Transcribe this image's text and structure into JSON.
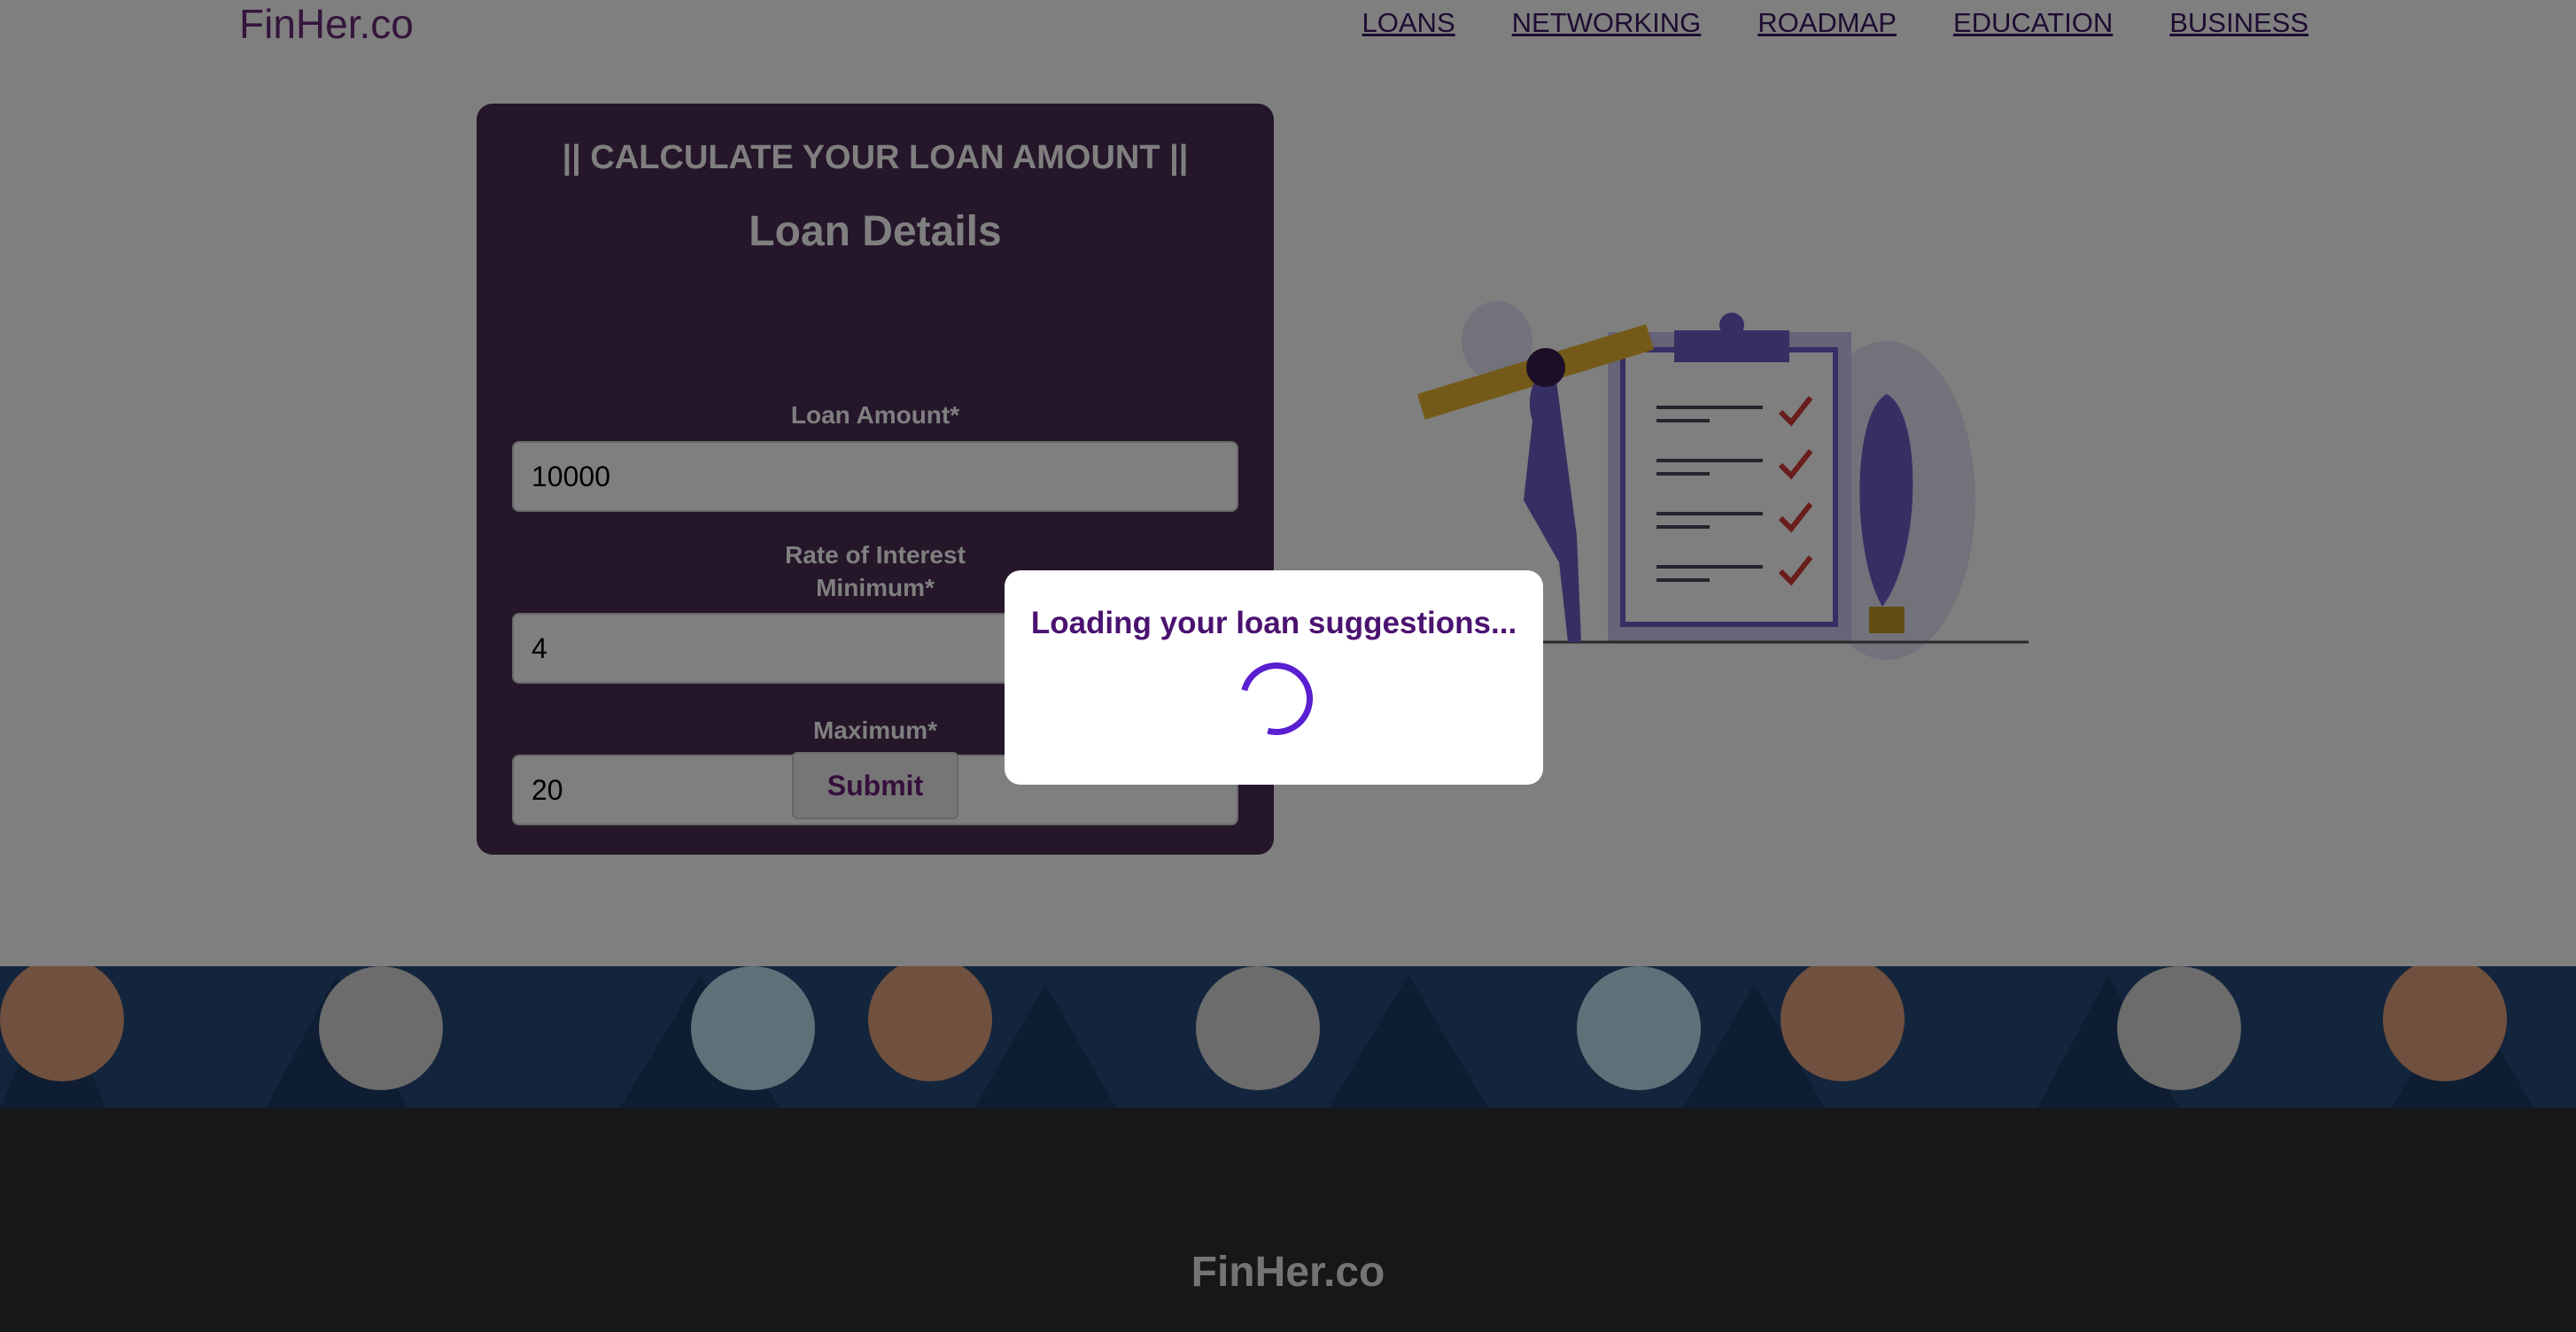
{
  "header": {
    "logo": "FinHer.co",
    "nav": [
      "LOANS",
      "NETWORKING",
      "ROADMAP",
      "EDUCATION",
      "BUSINESS"
    ]
  },
  "form": {
    "tagline": "|| CALCULATE YOUR LOAN AMOUNT ||",
    "title": "Loan Details",
    "loan_amount_label": "Loan Amount*",
    "loan_amount_value": "10000",
    "rate_label_line1": "Rate of Interest",
    "rate_label_line2": "Minimum*",
    "rate_min_value": "4",
    "rate_max_label": "Maximum*",
    "rate_max_value": "20",
    "submit_label": "Submit"
  },
  "modal": {
    "message": "Loading your loan suggestions..."
  },
  "footer": {
    "logo": "FinHer.co"
  },
  "colors": {
    "brand": "#6b2a78",
    "nav": "#3b1a63",
    "spinner": "#5a1fd1",
    "card_bg": "#4a2c55"
  },
  "icons": [
    "spinner-icon",
    "illustration-checklist",
    "footer-pattern"
  ]
}
